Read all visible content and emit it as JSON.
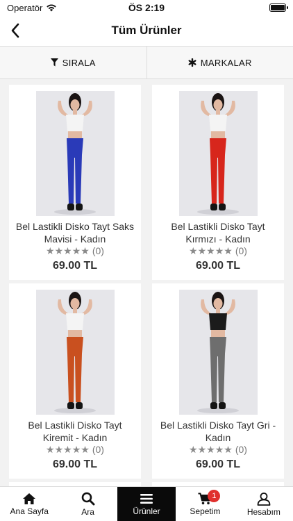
{
  "status": {
    "carrier": "Operatör",
    "time": "ÖS 2:19",
    "battery_level": 1.0
  },
  "header": {
    "title": "Tüm Ürünler",
    "back_icon": "chevron-left-icon"
  },
  "filters": {
    "sort_label": "SIRALA",
    "sort_icon": "funnel-icon",
    "brands_label": "MARKALAR",
    "brands_icon": "asterisk-icon"
  },
  "products": [
    {
      "name": "Bel Lastikli Disko Tayt Saks Mavisi - Kadın",
      "rating_count": "(0)",
      "stars": 0,
      "price": "69.00 TL",
      "top_color": "#f4f4f4",
      "legging_color": "#2a3ab8"
    },
    {
      "name": "Bel Lastikli Disko Tayt Kırmızı - Kadın",
      "rating_count": "(0)",
      "stars": 0,
      "price": "69.00 TL",
      "top_color": "#f4f4f4",
      "legging_color": "#d7261c"
    },
    {
      "name": "Bel Lastikli Disko Tayt Kiremit - Kadın",
      "rating_count": "(0)",
      "stars": 0,
      "price": "69.00 TL",
      "top_color": "#f4f4f4",
      "legging_color": "#c9501f"
    },
    {
      "name": "Bel Lastikli Disko Tayt Gri - Kadın",
      "rating_count": "(0)",
      "stars": 0,
      "price": "69.00 TL",
      "top_color": "#1b1b1b",
      "legging_color": "#6e6e6e"
    }
  ],
  "tabs": [
    {
      "label": "Ana Sayfa",
      "icon": "home-icon",
      "active": false
    },
    {
      "label": "Ara",
      "icon": "search-icon",
      "active": false
    },
    {
      "label": "Ürünler",
      "icon": "menu-icon",
      "active": true
    },
    {
      "label": "Sepetim",
      "icon": "cart-icon",
      "active": false,
      "badge": "1"
    },
    {
      "label": "Hesabım",
      "icon": "user-icon",
      "active": false
    }
  ],
  "colors": {
    "active_tab": "#0a0a0a",
    "badge": "#e0302e",
    "star": "#8a8a8a"
  }
}
